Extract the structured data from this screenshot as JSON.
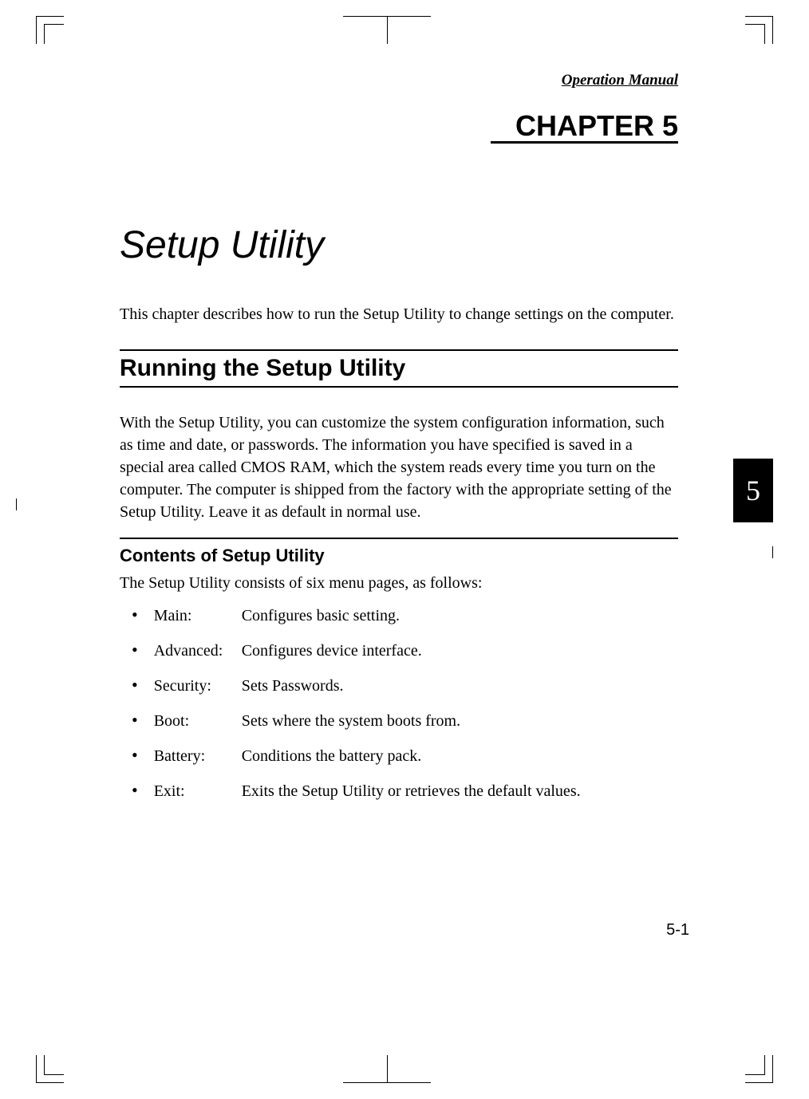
{
  "header": "Operation Manual",
  "chapter_label": "CHAPTER 5",
  "title": "Setup Utility",
  "intro": "This chapter describes how to run the Setup Utility to change settings on the computer.",
  "section_heading": "Running the Setup Utility",
  "body": "With the Setup Utility, you can customize the system configuration information, such as time and date, or passwords.  The information you have specified is saved in a special area called CMOS RAM, which the system reads every time you turn on the computer. The computer is shipped from the factory with the appropriate setting of the Setup Utility. Leave it as default in normal use.",
  "subsection_heading": "Contents of Setup Utility",
  "list_intro": "The Setup Utility consists of six menu pages, as follows:",
  "menu_items": [
    {
      "label": "Main:",
      "description": "Configures basic setting."
    },
    {
      "label": "Advanced:",
      "description": "Configures device interface."
    },
    {
      "label": "Security:",
      "description": "Sets Passwords."
    },
    {
      "label": "Boot:",
      "description": "Sets where the system boots from."
    },
    {
      "label": "Battery:",
      "description": "Conditions the battery pack."
    },
    {
      "label": "Exit:",
      "description": "Exits the Setup Utility or retrieves the default values."
    }
  ],
  "chapter_number": "5",
  "page_number": "5-1"
}
